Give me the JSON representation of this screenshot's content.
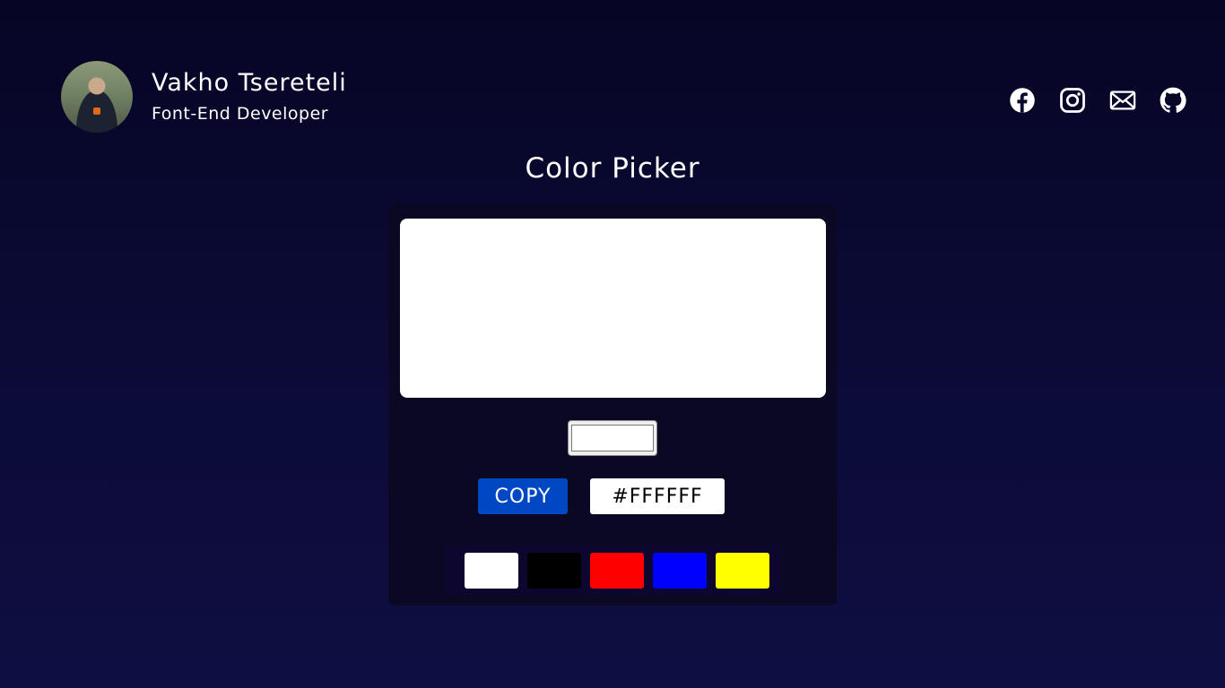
{
  "profile": {
    "name": "Vakho Tsereteli",
    "role": "Font-End Developer"
  },
  "socials": [
    {
      "icon": "facebook-icon"
    },
    {
      "icon": "instagram-icon"
    },
    {
      "icon": "mail-icon"
    },
    {
      "icon": "github-icon"
    }
  ],
  "page_title": "Color Picker",
  "picker": {
    "current_color": "#FFFFFF",
    "copy_label": "COPY",
    "hex_value": "#FFFFFF"
  },
  "palette": [
    {
      "color": "#FFFFFF"
    },
    {
      "color": "#000000"
    },
    {
      "color": "#FF0000"
    },
    {
      "color": "#0000FF"
    },
    {
      "color": "#FFFF00"
    }
  ],
  "colors": {
    "copy_button": "#0047C4",
    "card_background": "#0A0822"
  }
}
